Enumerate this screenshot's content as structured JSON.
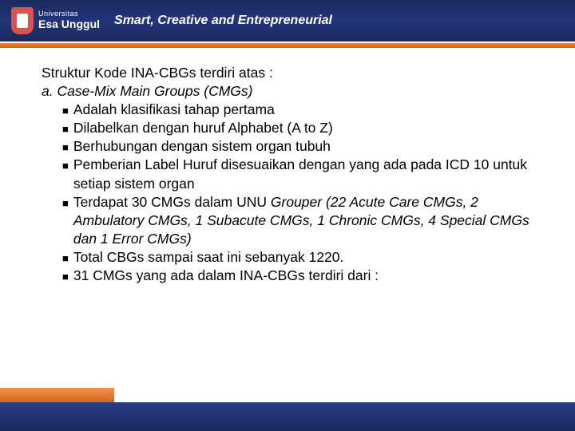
{
  "header": {
    "logo_top": "Universitas",
    "logo_bottom": "Esa Unggul",
    "tagline": "Smart, Creative and Entrepreneurial"
  },
  "content": {
    "title": "Struktur Kode INA-CBGs terdiri atas :",
    "subhead": "a. Case-Mix Main Groups (CMGs)",
    "bullets": [
      {
        "text": " Adalah klasifikasi tahap pertama"
      },
      {
        "text": "Dilabelkan dengan huruf Alphabet (A to Z)"
      },
      {
        "text": "Berhubungan dengan sistem organ tubuh"
      },
      {
        "text": "Pemberian Label Huruf disesuaikan dengan yang ada pada ICD 10 untuk setiap sistem organ"
      },
      {
        "pre": "Terdapat 30 CMGs dalam UNU ",
        "italic": "Grouper (22 Acute Care CMGs, 2 Ambulatory CMGs, 1 Subacute CMGs, 1 Chronic CMGs, 4 Special CMGs dan 1 Error CMGs)"
      },
      {
        "text": "Total CBGs sampai saat ini sebanyak 1220."
      },
      {
        "text": "31 CMGs yang ada dalam INA-CBGs terdiri dari :"
      }
    ]
  }
}
